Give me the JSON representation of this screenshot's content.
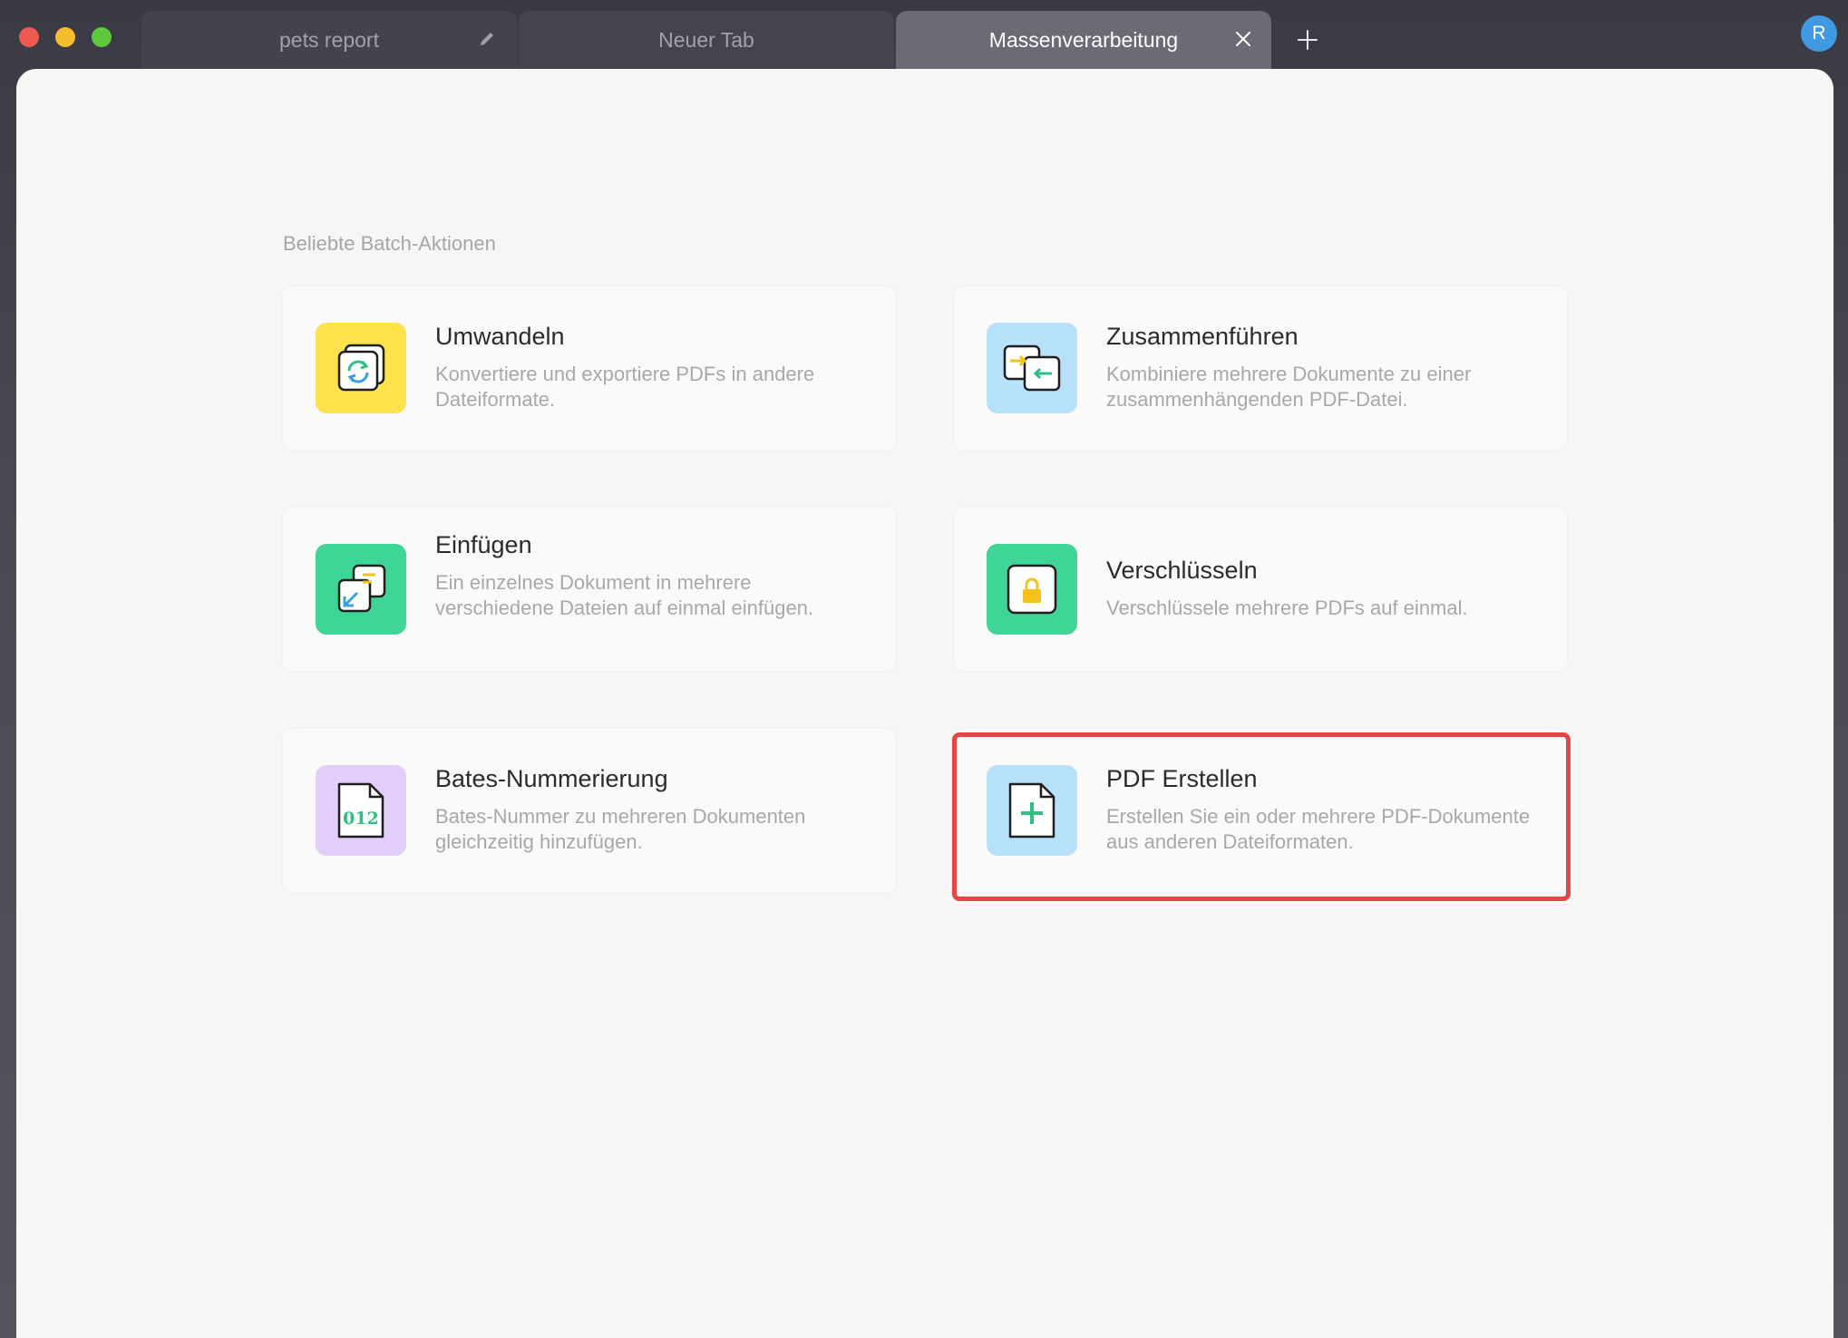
{
  "tabs": [
    {
      "label": "pets report",
      "active": false
    },
    {
      "label": "Neuer Tab",
      "active": false
    },
    {
      "label": "Massenverarbeitung",
      "active": true
    }
  ],
  "user": {
    "avatar_initial": "R",
    "avatar_color": "#3f9ae2"
  },
  "section_title": "Beliebte Batch-Aktionen",
  "actions": [
    {
      "title": "Umwandeln",
      "desc": "Konvertiere und exportiere PDFs in andere Dateiformate.",
      "icon": "convert-icon",
      "icon_bg": "#fde24b"
    },
    {
      "title": "Zusammenführen",
      "desc": "Kombiniere mehrere Dokumente zu einer zusammenhängenden PDF-Datei.",
      "icon": "merge-icon",
      "icon_bg": "#b7e1fa"
    },
    {
      "title": "Einfügen",
      "desc": "Ein einzelnes Dokument in mehrere verschiedene Dateien auf einmal einfügen.",
      "icon": "insert-icon",
      "icon_bg": "#3fd596"
    },
    {
      "title": "Verschlüsseln",
      "desc": "Verschlüssele mehrere PDFs auf einmal.",
      "icon": "lock-icon",
      "icon_bg": "#3fd596"
    },
    {
      "title": "Bates-Nummerierung",
      "desc": "Bates-Nummer zu mehreren Dokumenten gleichzeitig hinzufügen.",
      "icon": "bates-number-icon",
      "icon_bg": "#e3cdfa",
      "icon_text": "012"
    },
    {
      "title": "PDF Erstellen",
      "desc": "Erstellen Sie ein oder mehrere PDF-Dokumente aus anderen Dateiformaten.",
      "icon": "create-pdf-icon",
      "icon_bg": "#b7e1fa",
      "highlighted": true
    }
  ],
  "colors": {
    "highlight": "#e64545"
  }
}
